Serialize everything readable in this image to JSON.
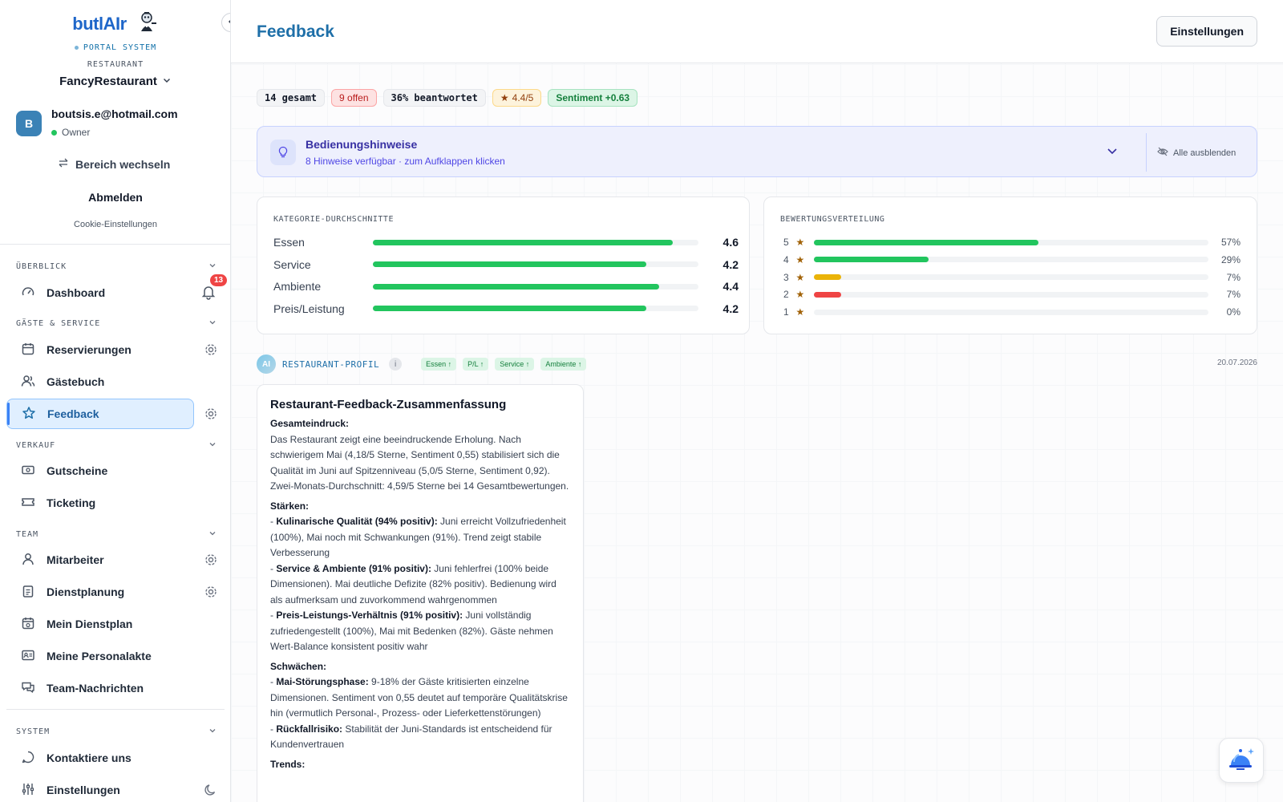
{
  "brand": {
    "logo_main": "butlAIr",
    "subtitle": "PORTAL SYSTEM"
  },
  "restaurant": {
    "label": "RESTAURANT",
    "name": "FancyRestaurant"
  },
  "user": {
    "initial": "B",
    "email": "boutsis.e@hotmail.com",
    "role": "Owner"
  },
  "account": {
    "switch_label": "Bereich wechseln",
    "logout_label": "Abmelden",
    "cookie_label": "Cookie-Einstellungen"
  },
  "sidebar": {
    "sections": [
      {
        "label": "ÜBERBLICK"
      },
      {
        "label": "GÄSTE & SERVICE"
      },
      {
        "label": "VERKAUF"
      },
      {
        "label": "TEAM"
      },
      {
        "label": "SYSTEM"
      }
    ],
    "items": [
      {
        "label": "Dashboard"
      },
      {
        "label": "Reservierungen"
      },
      {
        "label": "Gästebuch"
      },
      {
        "label": "Feedback"
      },
      {
        "label": "Gutscheine"
      },
      {
        "label": "Ticketing"
      },
      {
        "label": "Mitarbeiter"
      },
      {
        "label": "Dienstplanung"
      },
      {
        "label": "Mein Dienstplan"
      },
      {
        "label": "Meine Personalakte"
      },
      {
        "label": "Team-Nachrichten"
      },
      {
        "label": "Kontaktiere uns"
      },
      {
        "label": "Einstellungen"
      }
    ],
    "notification_count": "13"
  },
  "header": {
    "title": "Feedback",
    "settings_label": "Einstellungen"
  },
  "stats": {
    "total": "14 gesamt",
    "open": "9 offen",
    "answered": "36% beantwortet",
    "rating": "4.4/5",
    "sentiment": "Sentiment +0.63"
  },
  "hints": {
    "title": "Bedienungshinweise",
    "subtitle": "8 Hinweise verfügbar · zum Aufklappen klicken",
    "hide_all": "Alle ausblenden"
  },
  "category_card": {
    "label": "KATEGORIE-DURCHSCHNITTE",
    "rows": [
      {
        "name": "Essen",
        "value": "4.6",
        "fraction": 0.92
      },
      {
        "name": "Service",
        "value": "4.2",
        "fraction": 0.84
      },
      {
        "name": "Ambiente",
        "value": "4.4",
        "fraction": 0.88
      },
      {
        "name": "Preis/Leistung",
        "value": "4.2",
        "fraction": 0.84
      }
    ]
  },
  "distribution_card": {
    "label": "BEWERTUNGSVERTEILUNG",
    "rows": [
      {
        "stars": "5",
        "pct": "57%",
        "fraction": 0.57,
        "color": "#22c55e"
      },
      {
        "stars": "4",
        "pct": "29%",
        "fraction": 0.29,
        "color": "#22c55e"
      },
      {
        "stars": "3",
        "pct": "7%",
        "fraction": 0.07,
        "color": "#eab308"
      },
      {
        "stars": "2",
        "pct": "7%",
        "fraction": 0.07,
        "color": "#ef4444"
      },
      {
        "stars": "1",
        "pct": "0%",
        "fraction": 0.0,
        "color": "#ef4444"
      }
    ]
  },
  "profile": {
    "badge": "AI",
    "label": "RESTAURANT-PROFIL",
    "info": "i",
    "tags": [
      "Essen ↑",
      "P/L ↑",
      "Service ↑",
      "Ambiente ↑"
    ],
    "date": "20.07.2026"
  },
  "summary": {
    "title": "Restaurant-Feedback-Zusammenfassung",
    "overall_heading": "Gesamteindruck:",
    "overall_text": "Das Restaurant zeigt eine beeindruckende Erholung. Nach schwierigem Mai (4,18/5 Sterne, Sentiment 0,55) stabilisiert sich die Qualität im Juni auf Spitzenniveau (5,0/5 Sterne, Sentiment 0,92). Zwei-Monats-Durchschnitt: 4,59/5 Sterne bei 14 Gesamtbewertungen.",
    "strengths_heading": "Stärken:",
    "strengths": [
      {
        "bold": "Kulinarische Qualität (94% positiv):",
        "text": " Juni erreicht Vollzufriedenheit (100%), Mai noch mit Schwankungen (91%). Trend zeigt stabile Verbesserung"
      },
      {
        "bold": "Service & Ambiente (91% positiv):",
        "text": " Juni fehlerfrei (100% beide Dimensionen). Mai deutliche Defizite (82% positiv). Bedienung wird als aufmerksam und zuvorkommend wahrgenommen"
      },
      {
        "bold": "Preis-Leistungs-Verhältnis (91% positiv):",
        "text": " Juni vollständig zufriedengestellt (100%), Mai mit Bedenken (82%). Gäste nehmen Wert-Balance konsistent positiv wahr"
      }
    ],
    "weaknesses_heading": "Schwächen:",
    "weaknesses": [
      {
        "bold": "Mai-Störungsphase:",
        "text": " 9-18% der Gäste kritisierten einzelne Dimensionen. Sentiment von 0,55 deutet auf temporäre Qualitätskrise hin (vermutlich Personal-, Prozess- oder Lieferkettenstörungen)"
      },
      {
        "bold": "Rückfallrisiko:",
        "text": " Stabilität der Juni-Standards ist entscheidend für Kundenvertrauen"
      }
    ],
    "trends_heading": "Trends:"
  }
}
